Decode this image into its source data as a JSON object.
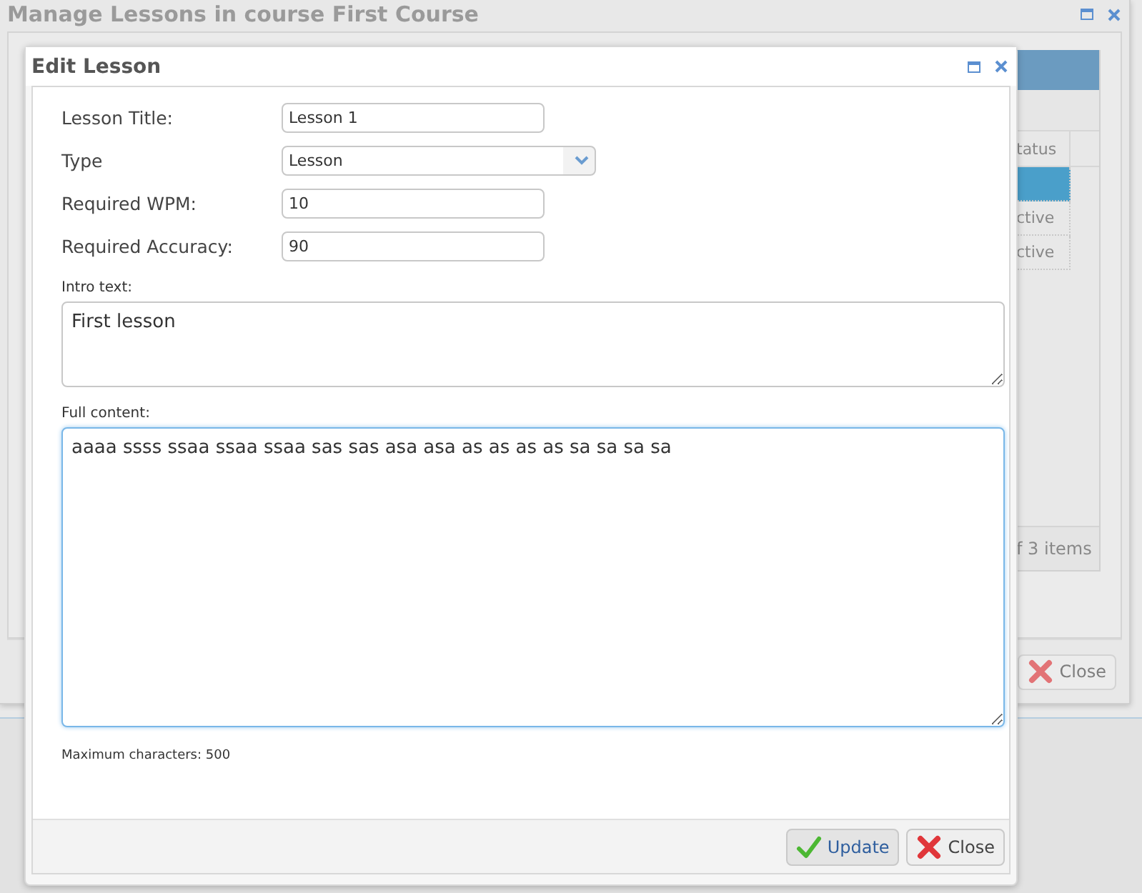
{
  "outer_window": {
    "title": "Manage Lessons in course First Course",
    "grid": {
      "column_header": "tatus",
      "rows": [
        {
          "selected": true
        },
        {
          "status": "ctive",
          "selected": false
        },
        {
          "status": "ctive",
          "selected": false
        }
      ],
      "pager": "f 3 items"
    },
    "close_button": "Close"
  },
  "dialog": {
    "title": "Edit Lesson",
    "fields": [
      {
        "kind": "text",
        "label": "Lesson Title:",
        "value": "Lesson 1"
      },
      {
        "kind": "select",
        "label": "Type",
        "value": "Lesson"
      },
      {
        "kind": "text",
        "label": "Required WPM:",
        "value": "10"
      },
      {
        "kind": "text",
        "label": "Required Accuracy:",
        "value": "90"
      }
    ],
    "areas": [
      {
        "label": "Intro text:",
        "value": "First lesson",
        "focused": false
      },
      {
        "label": "Full content:",
        "value": "aaaa ssss ssaa ssaa ssaa sas sas asa asa as as as as sa sa sa sa",
        "focused": true
      }
    ],
    "hint": "Maximum characters: 500",
    "buttons": [
      {
        "kind": "update",
        "label": "Update"
      },
      {
        "kind": "close",
        "label": "Close"
      }
    ]
  }
}
